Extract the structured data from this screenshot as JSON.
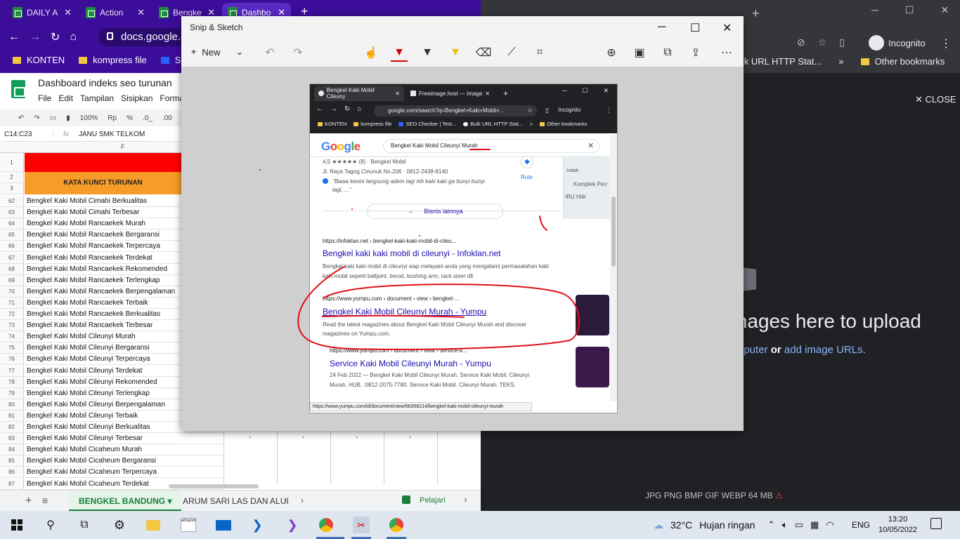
{
  "left_browser": {
    "tabs": [
      {
        "label": "DAILY A"
      },
      {
        "label": "Action"
      },
      {
        "label": "Bengke"
      },
      {
        "label": "Dashbo"
      }
    ],
    "url": "docs.google.co",
    "bookmarks": [
      {
        "label": "KONTEN"
      },
      {
        "label": "kompress file"
      },
      {
        "label": "SEO"
      }
    ]
  },
  "sheets": {
    "doc_title": "Dashboard indeks seo turunan",
    "menu": [
      "File",
      "Edit",
      "Tampilan",
      "Sisipkan",
      "Format"
    ],
    "toolbar": {
      "zoom": "100%",
      "currency": "Rp",
      "percent": "%",
      "dec1": ".0_",
      "dec2": ".00"
    },
    "cell_ref": "C14:C23",
    "formula_value": "JANU SMK TELKOM",
    "col_header": "F",
    "header_label": "KATA KUNCI TURUNAN",
    "header_rows": [
      "1",
      "2",
      "3"
    ],
    "rows": [
      {
        "num": "62",
        "text": "Bengkel Kaki Mobil Cimahi Berkualitas"
      },
      {
        "num": "63",
        "text": "Bengkel Kaki Mobil Cimahi Terbesar"
      },
      {
        "num": "64",
        "text": "Bengkel Kaki Mobil Rancaekek Murah"
      },
      {
        "num": "65",
        "text": "Bengkel Kaki Mobil Rancaekek Bergaransi"
      },
      {
        "num": "66",
        "text": "Bengkel Kaki Mobil Rancaekek Terpercaya"
      },
      {
        "num": "67",
        "text": "Bengkel Kaki Mobil Rancaekek Terdekat"
      },
      {
        "num": "68",
        "text": "Bengkel Kaki Mobil Rancaekek Rekomended"
      },
      {
        "num": "69",
        "text": "Bengkel Kaki Mobil Rancaekek Terlengkap"
      },
      {
        "num": "70",
        "text": "Bengkel Kaki Mobil Rancaekek Berpengalaman"
      },
      {
        "num": "71",
        "text": "Bengkel Kaki Mobil Rancaekek Terbaik"
      },
      {
        "num": "72",
        "text": "Bengkel Kaki Mobil Rancaekek Berkualitas"
      },
      {
        "num": "73",
        "text": "Bengkel Kaki Mobil Rancaekek Terbesar"
      },
      {
        "num": "74",
        "text": "Bengkel Kaki Mobil Cileunyi Murah"
      },
      {
        "num": "75",
        "text": "Bengkel Kaki Mobil Cileunyi Bergaransi"
      },
      {
        "num": "76",
        "text": "Bengkel Kaki Mobil Cileunyi Terpercaya"
      },
      {
        "num": "77",
        "text": "Bengkel Kaki Mobil Cileunyi Terdekat"
      },
      {
        "num": "78",
        "text": "Bengkel Kaki Mobil Cileunyi Rekomended"
      },
      {
        "num": "79",
        "text": "Bengkel Kaki Mobil Cileunyi Terlengkap"
      },
      {
        "num": "80",
        "text": "Bengkel Kaki Mobil Cileunyi Berpengalaman"
      },
      {
        "num": "81",
        "text": "Bengkel Kaki Mobil Cileunyi Terbaik"
      },
      {
        "num": "82",
        "text": "Bengkel Kaki Mobil Cileunyi Berkualitas"
      },
      {
        "num": "83",
        "text": "Bengkel Kaki Mobil Cileunyi Terbesar"
      },
      {
        "num": "84",
        "text": "Bengkel Kaki Mobil Cicaheum Murah"
      },
      {
        "num": "85",
        "text": "Bengkel Kaki Mobil Cicaheum Bergaransi"
      },
      {
        "num": "86",
        "text": "Bengkel Kaki Mobil Cicaheum Terpercaya"
      },
      {
        "num": "87",
        "text": "Bengkel Kaki Mobil Cicaheum Terdekat"
      }
    ],
    "dash": "-",
    "sheet_tabs": {
      "active": "BENGKEL BANDUNG",
      "second": "ARUM SARI LAS DAN ALUI"
    },
    "learn_label": "Pelajari"
  },
  "right_browser": {
    "incognito_label": "Incognito",
    "bookmark1": "Bulk URL HTTP Stat...",
    "bookmark2": "Other bookmarks",
    "close_label": "CLOSE",
    "upload_text": "mages here to upload",
    "upload_sub_1": "nputer",
    "upload_sub_or": "or",
    "upload_sub_link": "add image URLs",
    "upload_sub_end": ".",
    "formats": "JPG PNG BMP GIF WEBP   64 MB"
  },
  "snip": {
    "title": "Snip & Sketch",
    "new_label": "New"
  },
  "inner": {
    "tab1": "Bengkel Kaki Mobil Cileuny",
    "tab2": "Freeimage.host — Image",
    "url": "google.com/search?q=Bengkel+Kaki+Mobil+...",
    "incognito": "Incognito",
    "bookmarks": [
      "KONTEN",
      "kompress file",
      "SEO Checker | Test...",
      "Bulk URL HTTP Stat...",
      "Other bookmarks"
    ],
    "logo": "Google",
    "query": "Bengkel Kaki Mobil Cileunyi Murah",
    "rating_line": "4,5 ★★★★★ (8) · Bengkel Mobil",
    "address_line": "Jl. Raya Tagog Cinunuk No.206 · 0812-2438-8140",
    "review_line1": "\"Bawa kesini langsung adem lagi nih kaki kaki ga bunyi bunyi",
    "review_line2": "lagi, ...\"",
    "rute_label": "Rute",
    "map_labels": [
      "Indah",
      "Komplek Perr",
      "IRU Hilir"
    ],
    "business_btn": "Bisnis lainnya",
    "result1_url": "https://infoklan.net › bengkel-kaki-kaki-mobil-di-cileu...",
    "result1_title": "Bengkel kaki kaki mobil di cileunyi - Infoklan.net",
    "result1_snip1": "Bengkel kaki kaki mobil di cileunyi siap melayani anda yang mengalami permasalahan kaki",
    "result1_snip2": "kaki mobil seperti balljoint, tierod, bushing arm, rack steer dll.",
    "result2_url": "https://www.yumpu.com › document › view › bengkel-...",
    "result2_title": "Bengkel Kaki Mobil Cileunyi Murah - Yumpu",
    "result2_snip1": "Read the latest magazines about Bengkel Kaki Mobil Cileunyi Murah and discover",
    "result2_snip2": "magazines on Yumpu.com.",
    "result3_url": "https://www.yumpu.com › document › view › service-k...",
    "result3_title": "Service Kaki Mobil Cileunyi Murah - Yumpu",
    "result3_snip1": "24 Feb 2022 — Bengkel Kaki Mobil Cileunyi Murah. Service Kaki Mobil. Cileunyi",
    "result3_snip2": "Murah. HUB. :0812-2075-7780. Service Kaki Mobil. Cileunyi Murah. TEKS.",
    "status_url": "https://www.yumpu.com/id/document/view/66356214/bengkel-kaki-mobil-cileunyi-murah"
  },
  "taskbar": {
    "temperature": "32°C",
    "weather": "Hujan ringan",
    "lang": "ENG",
    "time": "13:20",
    "date": "10/05/2022"
  },
  "colors": {
    "left_chrome": "#3c0d99",
    "sheet_red": "#ff0000",
    "sheet_orange": "#f79c28",
    "annotation_red": "#e0101a",
    "dark_bg": "#202124",
    "link_blue": "#1a0dab"
  }
}
